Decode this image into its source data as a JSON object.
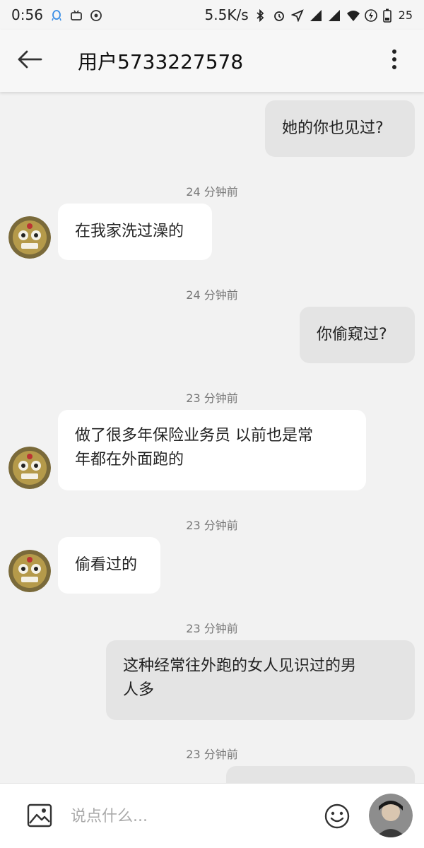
{
  "status_bar": {
    "time": "0:56",
    "net_speed": "5.5K/s",
    "battery": "25"
  },
  "header": {
    "title": "用户5733227578"
  },
  "messages": [
    {
      "dir": "out",
      "text": "她的你也见过?"
    },
    {
      "ts": "24 分钟前",
      "dir": "in",
      "text": "在我家洗过澡的"
    },
    {
      "ts": "24 分钟前",
      "dir": "out",
      "text": "你偷窥过?"
    },
    {
      "ts": "23 分钟前",
      "dir": "in",
      "line1": "做了很多年保险业务员 以前也是常",
      "line2": "年都在外面跑的"
    },
    {
      "ts": "23 分钟前",
      "dir": "in",
      "text": "偷看过的"
    },
    {
      "ts": "23 分钟前",
      "dir": "out",
      "line1": "这种经常往外跑的女人见识过的男",
      "line2": "人多"
    },
    {
      "ts": "23 分钟前"
    }
  ],
  "input": {
    "placeholder": "说点什么..."
  },
  "colors": {
    "background": "#f2f2f2",
    "incoming_bubble": "#ffffff",
    "outgoing_bubble": "#e4e4e4"
  },
  "icons": [
    "back-arrow-icon",
    "more-vert-icon",
    "image-icon",
    "emoji-icon"
  ]
}
